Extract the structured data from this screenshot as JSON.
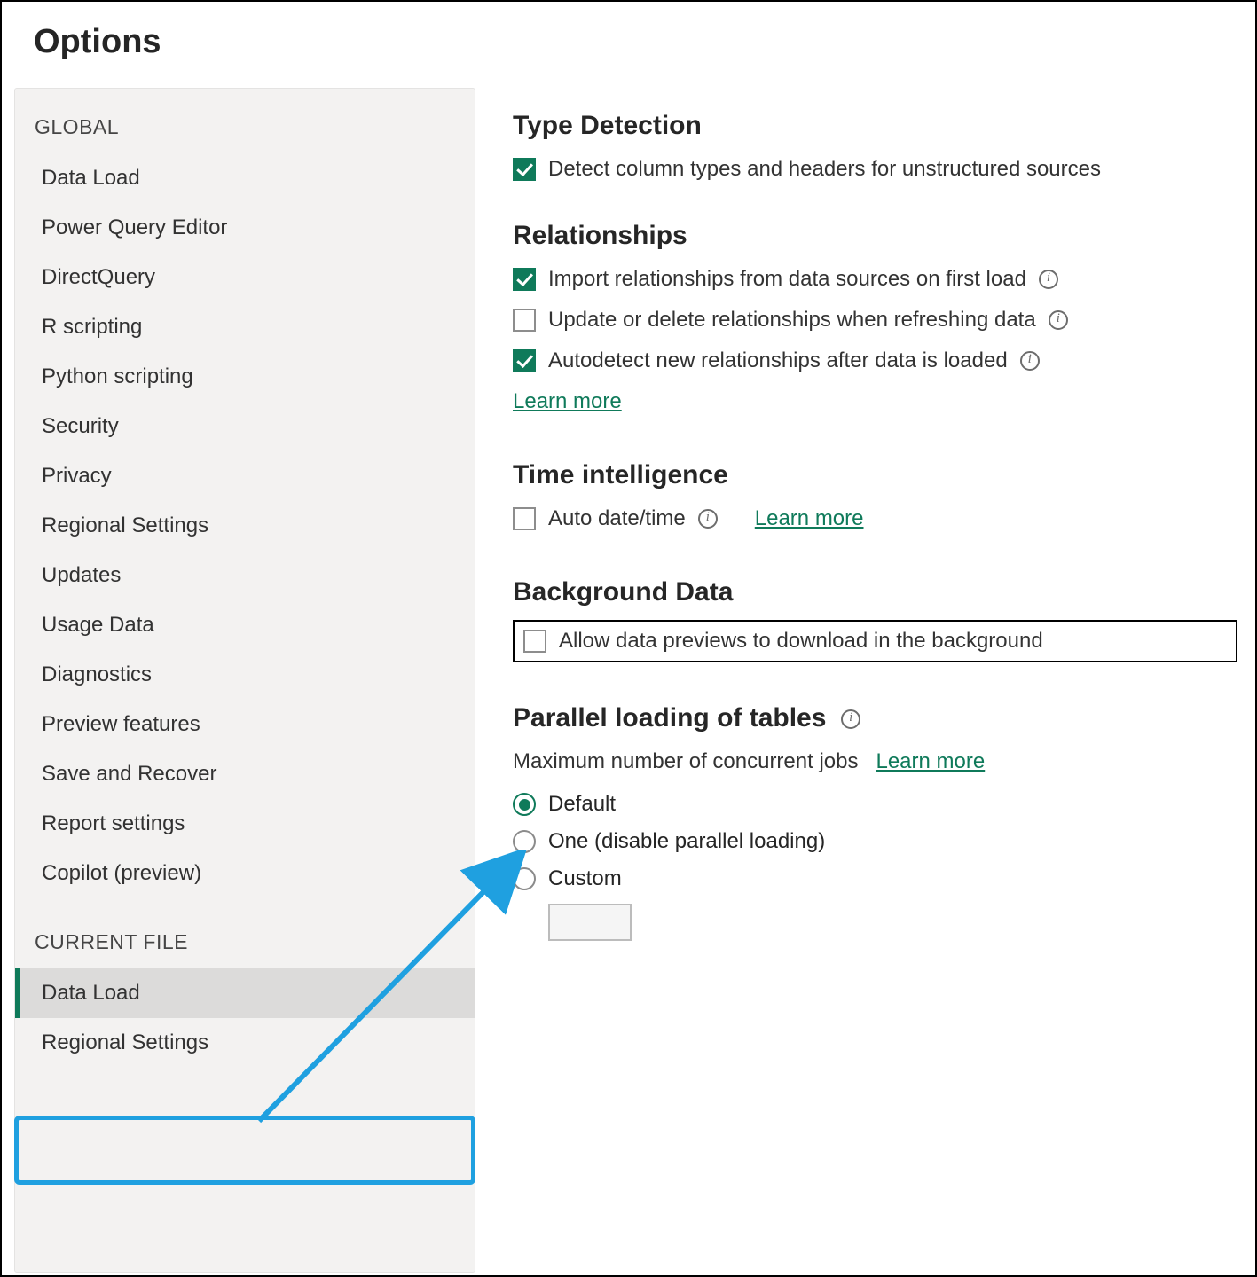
{
  "title": "Options",
  "colors": {
    "accent": "#0f7a5a",
    "annotation": "#1fa0e0"
  },
  "sidebar": {
    "sections": [
      {
        "header": "GLOBAL",
        "items": [
          {
            "label": "Data Load",
            "active": false
          },
          {
            "label": "Power Query Editor",
            "active": false
          },
          {
            "label": "DirectQuery",
            "active": false
          },
          {
            "label": "R scripting",
            "active": false
          },
          {
            "label": "Python scripting",
            "active": false
          },
          {
            "label": "Security",
            "active": false
          },
          {
            "label": "Privacy",
            "active": false
          },
          {
            "label": "Regional Settings",
            "active": false
          },
          {
            "label": "Updates",
            "active": false
          },
          {
            "label": "Usage Data",
            "active": false
          },
          {
            "label": "Diagnostics",
            "active": false
          },
          {
            "label": "Preview features",
            "active": false
          },
          {
            "label": "Save and Recover",
            "active": false
          },
          {
            "label": "Report settings",
            "active": false
          },
          {
            "label": "Copilot (preview)",
            "active": false
          }
        ]
      },
      {
        "header": "CURRENT FILE",
        "items": [
          {
            "label": "Data Load",
            "active": true
          },
          {
            "label": "Regional Settings",
            "active": false
          }
        ]
      }
    ]
  },
  "content": {
    "type_detection": {
      "title": "Type Detection",
      "item1": {
        "label": "Detect column types and headers for unstructured sources",
        "checked": true
      }
    },
    "relationships": {
      "title": "Relationships",
      "item1": {
        "label": "Import relationships from data sources on first load",
        "checked": true,
        "info": true
      },
      "item2": {
        "label": "Update or delete relationships when refreshing data",
        "checked": false,
        "info": true
      },
      "item3": {
        "label": "Autodetect new relationships after data is loaded",
        "checked": true,
        "info": true
      },
      "learn_more": "Learn more"
    },
    "time_intelligence": {
      "title": "Time intelligence",
      "item1": {
        "label": "Auto date/time",
        "checked": false,
        "info": true
      },
      "learn_more": "Learn more"
    },
    "background_data": {
      "title": "Background Data",
      "item1": {
        "label": "Allow data previews to download in the background",
        "checked": false
      }
    },
    "parallel": {
      "title": "Parallel loading of tables",
      "info": true,
      "label": "Maximum number of concurrent jobs",
      "learn_more": "Learn more",
      "options": {
        "default": "Default",
        "one": "One (disable parallel loading)",
        "custom": "Custom"
      },
      "selected": "default"
    }
  }
}
